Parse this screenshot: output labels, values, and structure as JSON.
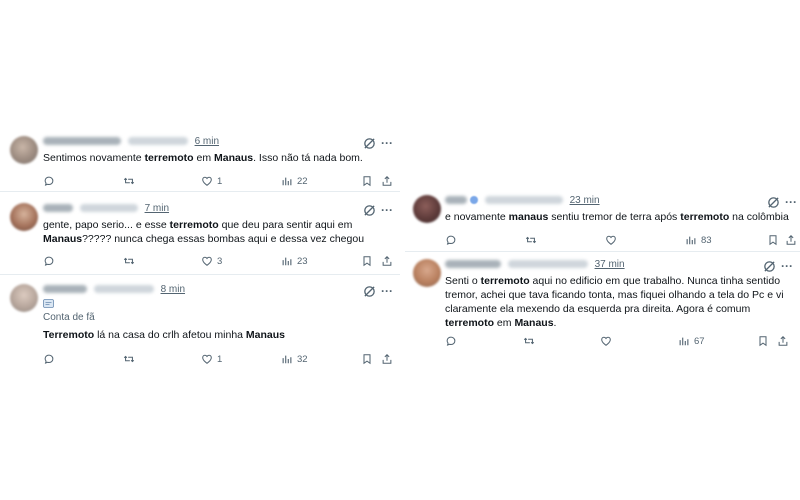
{
  "left_tweets": [
    {
      "time": "6 min",
      "text_html": "Sentimos novamente <b>terremoto</b> em <b>Manaus</b>. Isso não tá nada bom.",
      "likes": "1",
      "views": "22"
    },
    {
      "time": "7 min",
      "text_html": "gente, papo serio... e esse <b>terremoto</b> que deu para sentir aqui em <b>Manaus</b>????? nunca chega essas bombas aqui e dessa vez chegou",
      "likes": "3",
      "views": "23"
    },
    {
      "time": "8 min",
      "fan_label": "Conta de fã",
      "text_html": "<b>Terremoto</b> lá na casa do crlh afetou minha <b>Manaus</b>",
      "likes": "1",
      "views": "32"
    }
  ],
  "right_tweets": [
    {
      "time": "23 min",
      "text_html": "e novamente <b>manaus</b> sentiu tremor de terra após <b>terremoto</b> na colômbia",
      "likes": "",
      "views": "83"
    },
    {
      "time": "37 min",
      "text_html": "Senti o <b>terremoto</b> aqui no edificio em que trabalho. Nunca tinha sentido tremor, achei que tava ficando tonta, mas fiquei olhando a tela do Pc e vi claramente ela mexendo da esquerda pra direita. Agora é comum <b>terremoto</b> em <b>Manaus</b>.",
      "likes": "",
      "views": "67"
    }
  ],
  "icons": {
    "reply": "speech-bubble-icon",
    "retweet": "retweet-icon",
    "like": "heart-icon",
    "views": "bar-chart-icon",
    "bookmark": "bookmark-icon",
    "share": "share-icon",
    "grok": "grok-slash-circle-icon",
    "more": "ellipsis-icon"
  },
  "colors": {
    "text": "#0f1419",
    "secondary": "#536471",
    "divider": "#e6ecf0"
  }
}
